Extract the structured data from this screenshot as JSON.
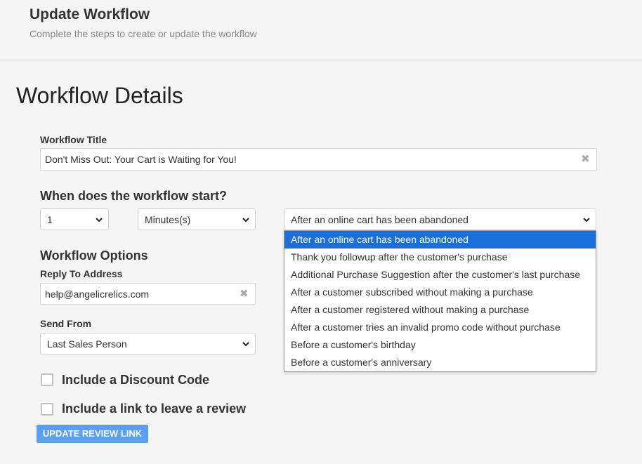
{
  "header": {
    "title": "Update Workflow",
    "subtitle": "Complete the steps to create or update the workflow"
  },
  "section_title": "Workflow Details",
  "workflow_title": {
    "label": "Workflow Title",
    "value": "Don't Miss Out: Your Cart is Waiting for You!"
  },
  "start": {
    "heading": "When does the workflow start?",
    "amount": "1",
    "unit": "Minutes(s)",
    "trigger": "After an online cart has been abandoned",
    "trigger_options": [
      "After an online cart has been abandoned",
      "Thank you followup after the customer's purchase",
      "Additional Purchase Suggestion after the customer's last purchase",
      "After a customer subscribed without making a purchase",
      "After a customer registered without making a purchase",
      "After a customer tries an invalid promo code without purchase",
      "Before a customer's birthday",
      "Before a customer's anniversary"
    ]
  },
  "options": {
    "heading": "Workflow Options",
    "reply_label": "Reply To Address",
    "reply_value": "help@angelicrelics.com",
    "send_from_label": "Send From",
    "send_from_value": "Last Sales Person",
    "discount_label": "Include a Discount Code",
    "review_label": "Include a link to leave a review",
    "update_button": "UPDATE REVIEW LINK"
  },
  "icons": {
    "clear": "close-icon",
    "dropdown": "chevron-down-icon"
  },
  "colors": {
    "accent": "#5aa0f2",
    "selected_option": "#1a6fd9"
  }
}
